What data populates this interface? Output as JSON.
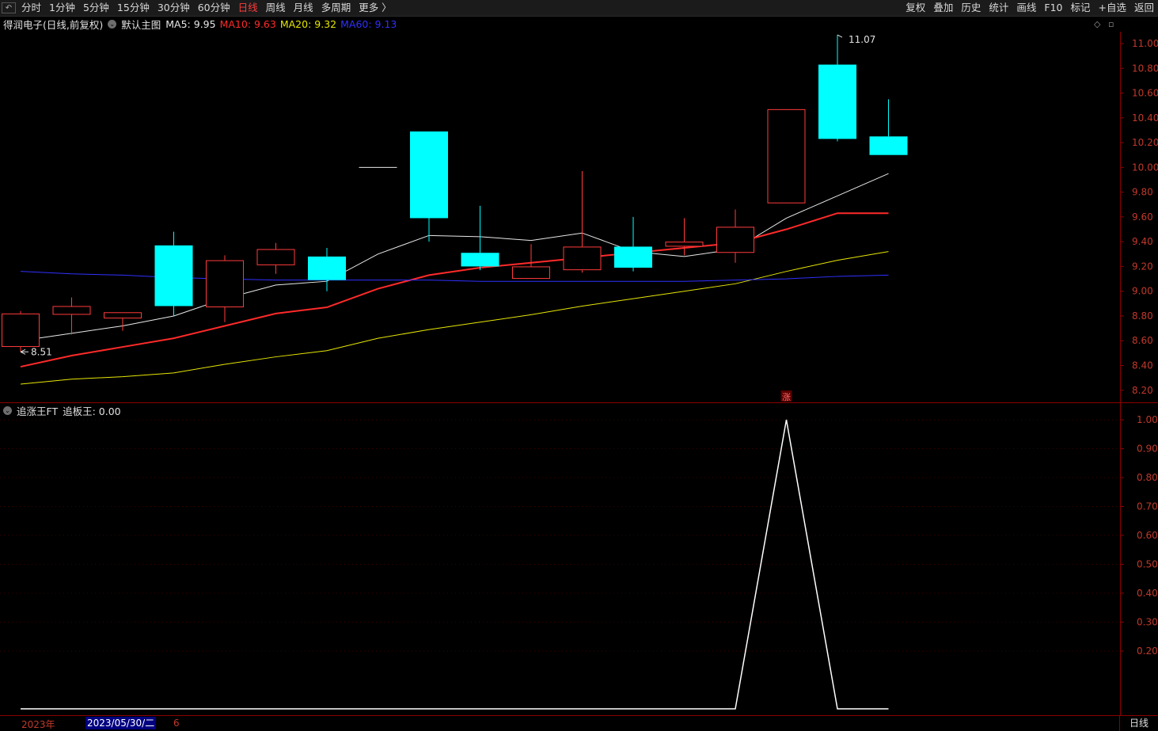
{
  "toolbar": {
    "lead_glyph": "↶",
    "periods": [
      "分时",
      "1分钟",
      "5分钟",
      "15分钟",
      "30分钟",
      "60分钟",
      "日线",
      "周线",
      "月线",
      "多周期",
      "更多 〉"
    ],
    "active_period": "日线",
    "right_buttons": [
      "复权",
      "叠加",
      "历史",
      "统计",
      "画线",
      "F10",
      "标记",
      "+自选",
      "返回"
    ]
  },
  "main_chart": {
    "stock_name": "得润电子",
    "mode": "(日线,前复权)",
    "template": "默认主图",
    "ma_labels": [
      {
        "text": "MA5: 9.95",
        "color": "#e8e8e8"
      },
      {
        "text": "MA10: 9.63",
        "color": "#ff2a2a"
      },
      {
        "text": "MA20: 9.32",
        "color": "#e6e600"
      },
      {
        "text": "MA60: 9.13",
        "color": "#3030ff"
      }
    ],
    "high_label": "11.07",
    "low_label": "8.51",
    "zhang_marker": "涨",
    "y_ticks": [
      "11.00",
      "10.80",
      "10.60",
      "10.40",
      "10.20",
      "10.00",
      "9.80",
      "9.60",
      "9.40",
      "9.20",
      "9.00",
      "8.80",
      "8.60",
      "8.40",
      "8.20"
    ],
    "corner_icons": [
      "diamond-icon",
      "square-icon"
    ]
  },
  "chart_data": [
    {
      "type": "candlestick",
      "title": "得润电子 (日线,前复权)",
      "ylim": [
        8.15,
        11.2
      ],
      "up_color": "#ff3b3b",
      "down_color": "#00ffff",
      "candles": [
        {
          "o": 8.55,
          "h": 8.84,
          "l": 8.51,
          "c": 8.82
        },
        {
          "o": 8.81,
          "h": 8.95,
          "l": 8.65,
          "c": 8.88
        },
        {
          "o": 8.78,
          "h": 8.83,
          "l": 8.68,
          "c": 8.83
        },
        {
          "o": 9.37,
          "h": 9.48,
          "l": 8.8,
          "c": 8.88
        },
        {
          "o": 8.87,
          "h": 9.29,
          "l": 8.75,
          "c": 9.25
        },
        {
          "o": 9.21,
          "h": 9.39,
          "l": 9.14,
          "c": 9.34
        },
        {
          "o": 9.28,
          "h": 9.35,
          "l": 9.0,
          "c": 9.09
        },
        {
          "o": 10.0,
          "h": 10.0,
          "l": 10.0,
          "c": 10.0
        },
        {
          "o": 10.29,
          "h": 10.29,
          "l": 9.4,
          "c": 9.59
        },
        {
          "o": 9.31,
          "h": 9.69,
          "l": 9.17,
          "c": 9.2
        },
        {
          "o": 9.1,
          "h": 9.38,
          "l": 9.1,
          "c": 9.2
        },
        {
          "o": 9.17,
          "h": 9.97,
          "l": 9.15,
          "c": 9.36
        },
        {
          "o": 9.36,
          "h": 9.6,
          "l": 9.16,
          "c": 9.19
        },
        {
          "o": 9.36,
          "h": 9.59,
          "l": 9.29,
          "c": 9.4
        },
        {
          "o": 9.31,
          "h": 9.66,
          "l": 9.23,
          "c": 9.52
        },
        {
          "o": 9.71,
          "h": 10.47,
          "l": 9.71,
          "c": 10.47
        },
        {
          "o": 10.83,
          "h": 11.07,
          "l": 10.21,
          "c": 10.23
        },
        {
          "o": 10.25,
          "h": 10.55,
          "l": 10.1,
          "c": 10.1
        }
      ],
      "series": [
        {
          "name": "MA5",
          "color": "#e8e8e8",
          "values": [
            8.6,
            8.66,
            8.72,
            8.8,
            8.94,
            9.05,
            9.08,
            9.3,
            9.45,
            9.44,
            9.41,
            9.47,
            9.32,
            9.28,
            9.34,
            9.59,
            9.77,
            9.95
          ]
        },
        {
          "name": "MA10",
          "color": "#ff2a2a",
          "values": [
            8.39,
            8.48,
            8.55,
            8.62,
            8.72,
            8.82,
            8.87,
            9.02,
            9.13,
            9.19,
            9.23,
            9.27,
            9.31,
            9.35,
            9.39,
            9.5,
            9.63,
            9.63
          ]
        },
        {
          "name": "MA20",
          "color": "#e6e600",
          "values": [
            8.25,
            8.29,
            8.31,
            8.34,
            8.41,
            8.47,
            8.52,
            8.62,
            8.69,
            8.75,
            8.81,
            8.88,
            8.94,
            9.0,
            9.06,
            9.16,
            9.25,
            9.32
          ]
        },
        {
          "name": "MA60",
          "color": "#3030ff",
          "values": [
            9.16,
            9.14,
            9.13,
            9.11,
            9.1,
            9.09,
            9.09,
            9.09,
            9.09,
            9.08,
            9.08,
            9.08,
            9.08,
            9.08,
            9.09,
            9.1,
            9.12,
            9.13
          ]
        }
      ]
    },
    {
      "type": "line",
      "title": "追涨王FT",
      "ylim": [
        0,
        1.05
      ],
      "series": [
        {
          "name": "追板王",
          "color": "#ffffff",
          "values": [
            0,
            0,
            0,
            0,
            0,
            0,
            0,
            0,
            0,
            0,
            0,
            0,
            0,
            0,
            0,
            1,
            0,
            0
          ]
        }
      ]
    }
  ],
  "indicator": {
    "name": "追涨王FT",
    "value_label": "追板王: 0.00",
    "y_ticks": [
      "1.00",
      "0.90",
      "0.80",
      "0.70",
      "0.60",
      "0.50",
      "0.40",
      "0.30",
      "0.20"
    ]
  },
  "bottom_bar": {
    "year": "2023年",
    "date": "2023/05/30/二",
    "extra": "6",
    "period": "日线"
  }
}
